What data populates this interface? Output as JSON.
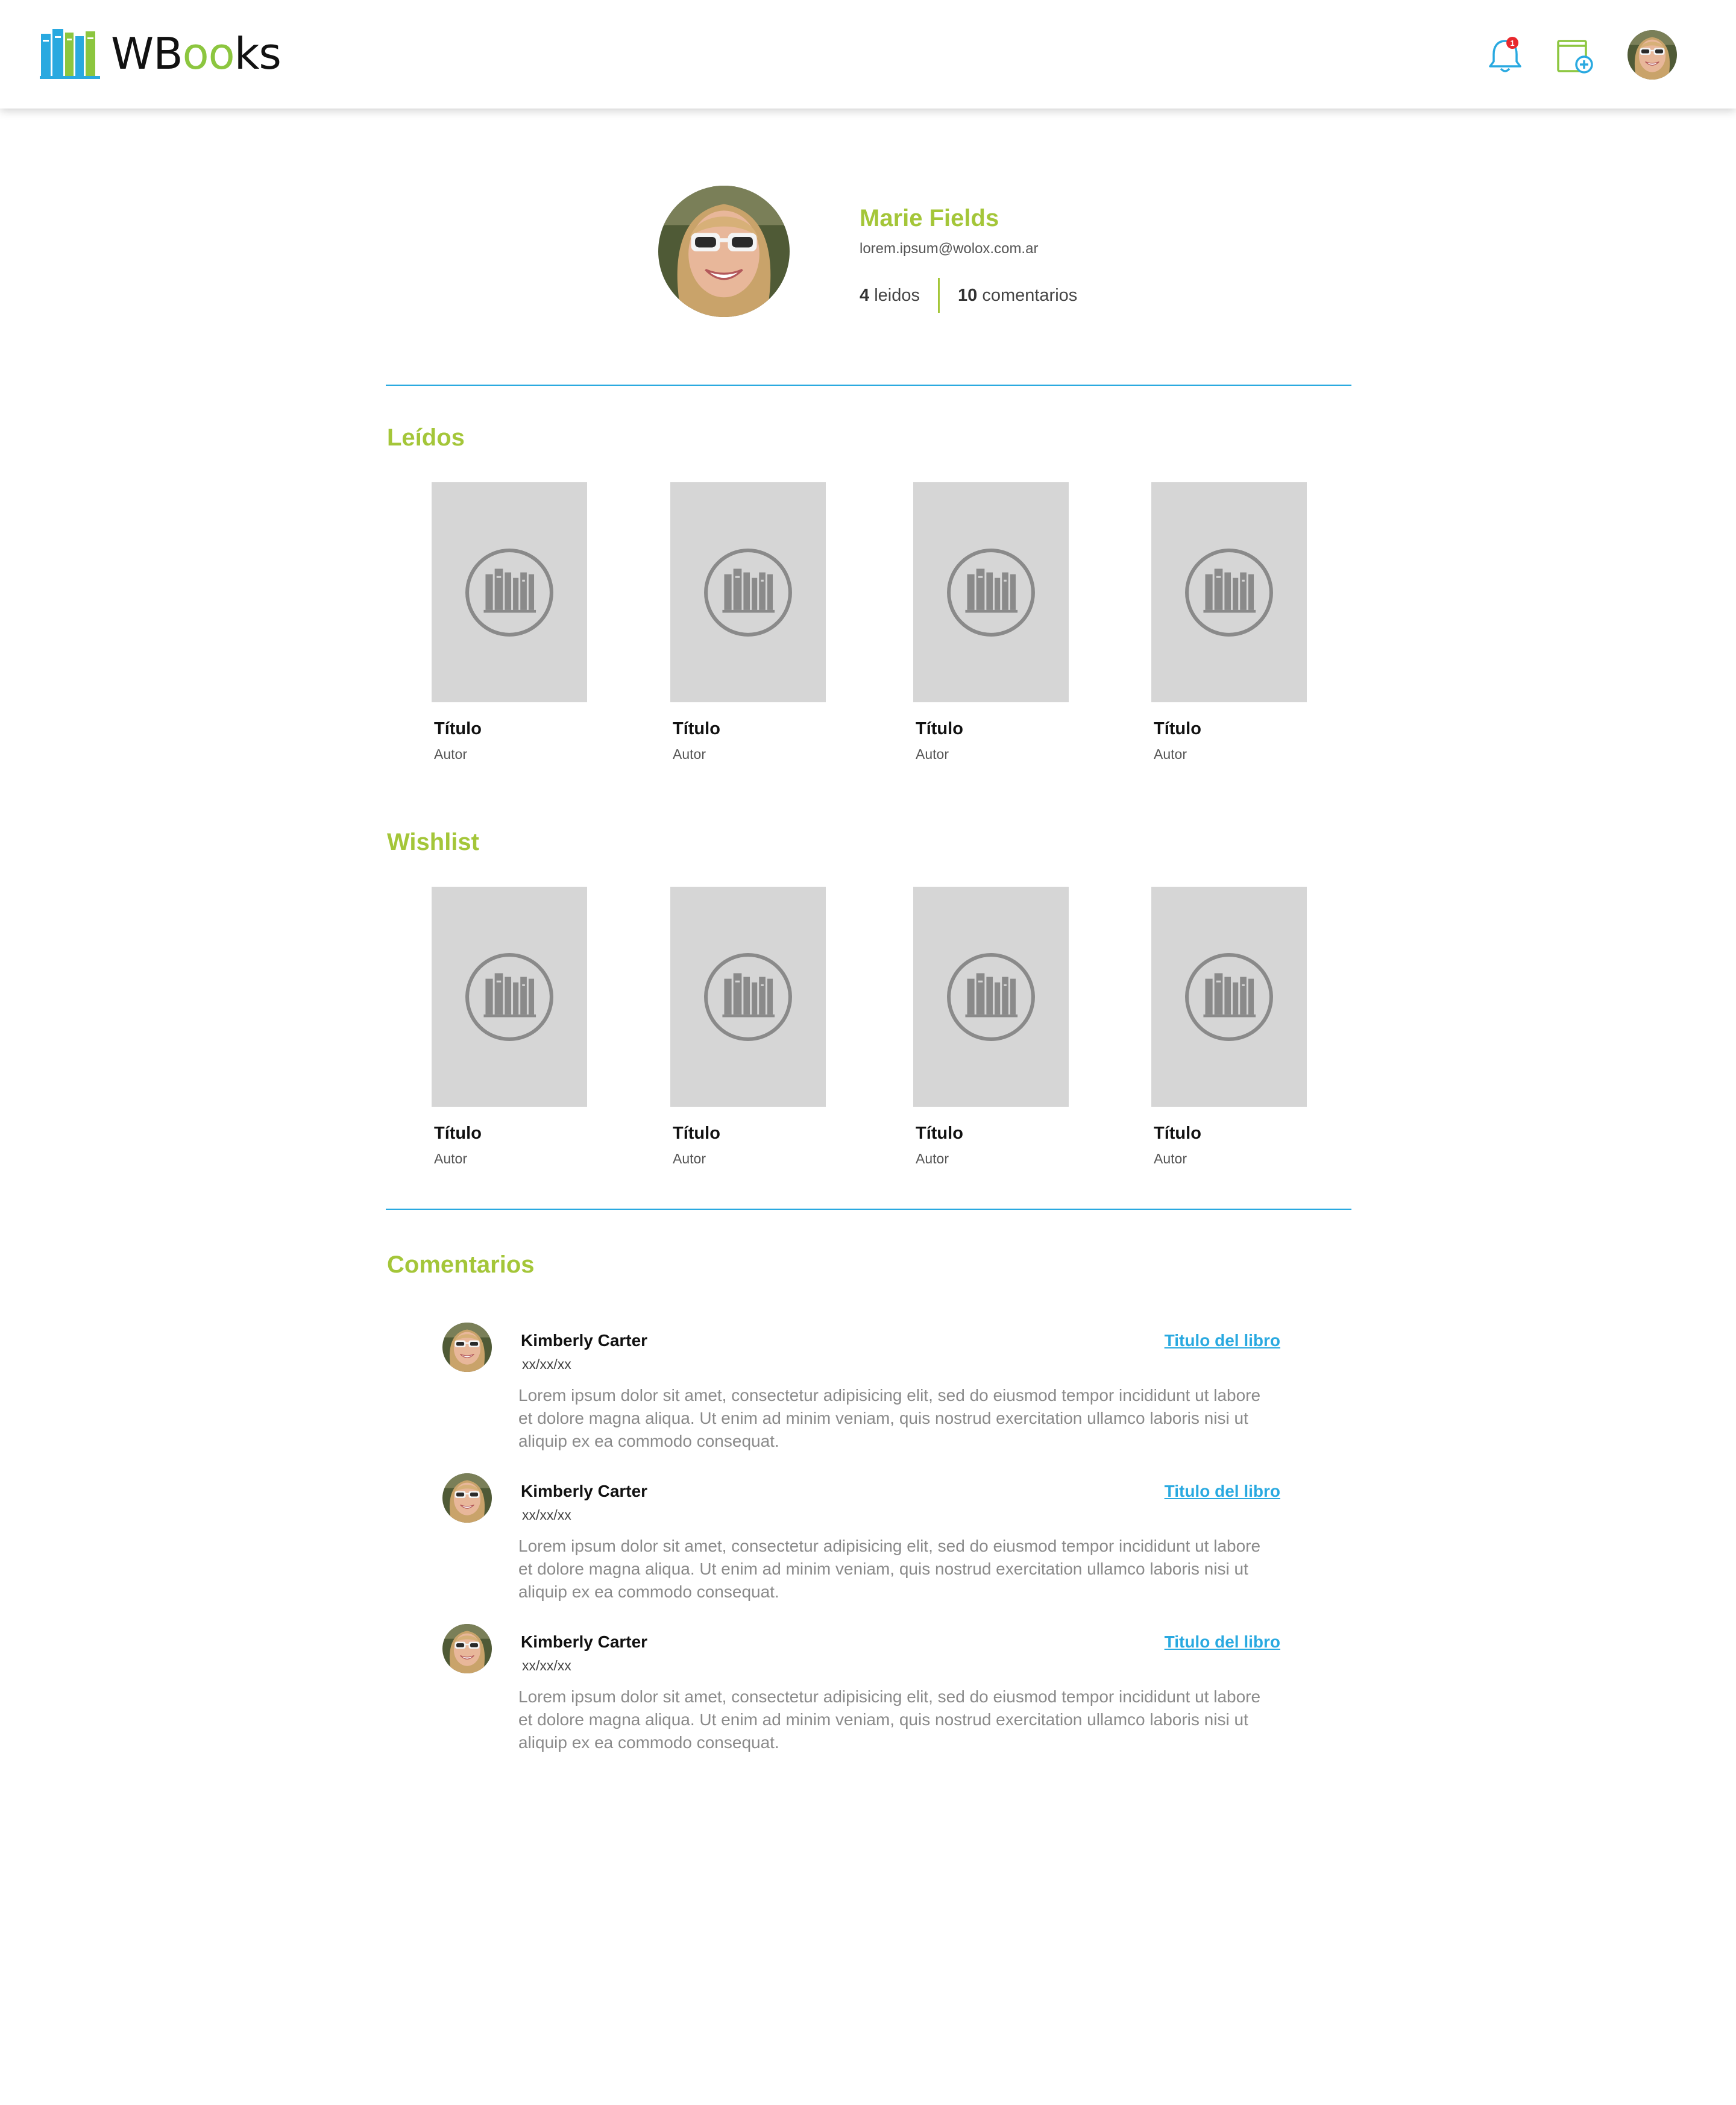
{
  "app": {
    "brand_prefix": "WB",
    "brand_highlight": "oo",
    "brand_suffix": "ks"
  },
  "header": {
    "notification_count": "1"
  },
  "colors": {
    "accent_green": "#a4c639",
    "accent_blue": "#29a9e0",
    "cover_placeholder": "#d6d6d6"
  },
  "profile": {
    "name": "Marie Fields",
    "email": "lorem.ipsum@wolox.com.ar",
    "read_count": "4",
    "read_label": "leidos",
    "comments_count": "10",
    "comments_label": "comentarios"
  },
  "read_section": {
    "title": "Leídos",
    "books": [
      {
        "title": "Título",
        "author": "Autor"
      },
      {
        "title": "Título",
        "author": "Autor"
      },
      {
        "title": "Título",
        "author": "Autor"
      },
      {
        "title": "Título",
        "author": "Autor"
      }
    ]
  },
  "wishlist_section": {
    "title": "Wishlist",
    "books": [
      {
        "title": "Título",
        "author": "Autor"
      },
      {
        "title": "Título",
        "author": "Autor"
      },
      {
        "title": "Título",
        "author": "Autor"
      },
      {
        "title": "Título",
        "author": "Autor"
      }
    ]
  },
  "comments_section": {
    "title": "Comentarios",
    "items": [
      {
        "author": "Kimberly Carter",
        "date": "xx/xx/xx",
        "book_link": "Titulo del libro",
        "text": "Lorem ipsum dolor sit amet, consectetur adipisicing elit, sed do eiusmod tempor incididunt ut labore et dolore magna aliqua. Ut enim ad minim veniam, quis nostrud exercitation ullamco laboris nisi ut aliquip ex ea commodo consequat."
      },
      {
        "author": "Kimberly Carter",
        "date": "xx/xx/xx",
        "book_link": "Titulo del libro",
        "text": "Lorem ipsum dolor sit amet, consectetur adipisicing elit, sed do eiusmod tempor incididunt ut labore et dolore magna aliqua. Ut enim ad minim veniam, quis nostrud exercitation ullamco laboris nisi ut aliquip ex ea commodo consequat."
      },
      {
        "author": "Kimberly Carter",
        "date": "xx/xx/xx",
        "book_link": "Titulo del libro",
        "text": "Lorem ipsum dolor sit amet, consectetur adipisicing elit, sed do eiusmod tempor incididunt ut labore et dolore magna aliqua. Ut enim ad minim veniam, quis nostrud exercitation ullamco laboris nisi ut aliquip ex ea commodo consequat."
      }
    ]
  }
}
